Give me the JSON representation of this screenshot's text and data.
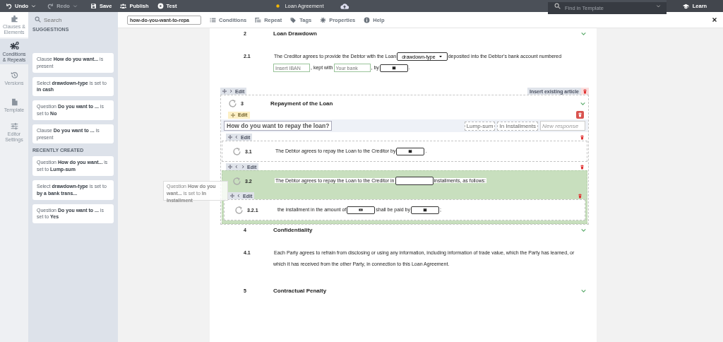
{
  "top_bar": {
    "actions": [
      {
        "kind": "undo",
        "label": "Undo",
        "disabled": false,
        "dropdown": true
      },
      {
        "kind": "redo",
        "label": "Redo",
        "disabled": true,
        "dropdown": true
      },
      {
        "kind": "save",
        "label": "Save",
        "disabled": false,
        "dropdown": false
      },
      {
        "kind": "publish",
        "label": "Publish",
        "disabled": false,
        "dropdown": false
      },
      {
        "kind": "test",
        "label": "Test",
        "disabled": false,
        "dropdown": false
      }
    ],
    "document_title": "Loan Agreement",
    "search": {
      "placeholder": "Find in Template"
    },
    "learn_button": "Learn"
  },
  "toolbar": {
    "name_field": {
      "value": "how-do-you-want-to-repa"
    },
    "tabs": [
      {
        "kind": "conditions",
        "label": "Conditions"
      },
      {
        "kind": "repeat",
        "label": "Repeat"
      },
      {
        "kind": "tags",
        "label": "Tags"
      },
      {
        "kind": "properties",
        "label": "Properties"
      },
      {
        "kind": "help",
        "label": "Help"
      }
    ]
  },
  "rail": {
    "items": [
      {
        "kind": "clauses",
        "label": "Clauses & Elements",
        "selected": false
      },
      {
        "kind": "conditions",
        "label": "Conditions & Repeats",
        "selected": true
      },
      {
        "kind": "versions",
        "label": "Versions",
        "selected": false
      },
      {
        "kind": "template",
        "label": "Template",
        "selected": false
      },
      {
        "kind": "settings",
        "label": "Editor Settings",
        "selected": false
      }
    ]
  },
  "sidebar": {
    "search": {
      "placeholder": "Search"
    },
    "sections": [
      {
        "title": "SUGGESTIONS",
        "items": [
          "Clause **How do you want...** is present",
          "Select **drawdown-type** is set to **in cash**",
          "Question **Do you want to ...** is set to **No**",
          "Clause **Do you want to ...** is present"
        ]
      },
      {
        "title": "RECENTLY CREATED",
        "items": [
          "Question **How do you want...** is set to **Lump-sum**",
          "Select **drawdown-type** is set to **by a bank trans...**",
          "Question **Do you want to ...** is set to **Yes**"
        ]
      }
    ]
  },
  "document": {
    "articles": [
      {
        "number": "2",
        "title": "Loan Drawdown",
        "clauses": [
          {
            "number": "2.1",
            "segments": [
              {
                "kind": "text",
                "text": "The Creditor agrees to provide the Debtor with the Loan"
              },
              {
                "kind": "select",
                "text": "drawdown-type"
              },
              {
                "kind": "text",
                "text": "deposited into the Debtor’s bank account"
              },
              {
                "kind": "text",
                "text": "numbered"
              },
              {
                "kind": "field",
                "placeholder": "Insert IBAN"
              },
              {
                "kind": "text",
                "text": ", kept with"
              },
              {
                "kind": "field",
                "placeholder": "Your bank"
              },
              {
                "kind": "text",
                "text": ", by"
              },
              {
                "kind": "date"
              },
              {
                "kind": "text",
                "text": "."
              }
            ]
          }
        ]
      },
      {
        "number": "3",
        "title": "Repayment of the Loan",
        "controls": {
          "nav": {
            "left": false,
            "right": true
          },
          "edit": "Edit",
          "insert": "Insert existing article"
        },
        "question": {
          "edit": "Edit",
          "text": "How do you want to repay the loan?",
          "responses": [
            "Lump-sum",
            "In Installments"
          ],
          "new_response": {
            "placeholder": "New response"
          }
        },
        "clauses": [
          {
            "number": "3.1",
            "nav": {
              "left": true,
              "right": false
            },
            "edit": "Edit",
            "selected": false,
            "segments": [
              {
                "kind": "text",
                "text": "The Debtor agrees to repay the Loan to the Creditor by"
              },
              {
                "kind": "date"
              },
              {
                "kind": "text",
                "text": "."
              }
            ]
          },
          {
            "number": "3.2",
            "nav": {
              "left": true,
              "right": true
            },
            "edit": "Edit",
            "selected": true,
            "segments": [
              {
                "kind": "text",
                "text": "The Debtor agrees to repay the Loan to the Creditor in"
              },
              {
                "kind": "field"
              },
              {
                "kind": "text",
                "text": "installments, as follows:"
              }
            ],
            "children": [
              {
                "number": "3.2.1",
                "nav": {
                  "left": true,
                  "right": false
                },
                "edit": "Edit",
                "selected": false,
                "segments": [
                  {
                    "kind": "text",
                    "text": "the installment in the amount of"
                  },
                  {
                    "kind": "money"
                  },
                  {
                    "kind": "text",
                    "text": "shall be paid by"
                  },
                  {
                    "kind": "date"
                  },
                  {
                    "kind": "text",
                    "text": ";"
                  }
                ]
              }
            ]
          }
        ]
      },
      {
        "number": "4",
        "title": "Confidentiality",
        "clauses": [
          {
            "number": "4.1",
            "segments": [
              {
                "kind": "text",
                "text": "Each Party agrees to refrain from disclosing or using any information, including information of trade value, which the Party has learned, or which it has received from the other Party, in connection to this Loan Agreement."
              }
            ]
          }
        ]
      },
      {
        "number": "5",
        "title": "Contractual Penalty"
      }
    ]
  },
  "drag_preview": {
    "text": "Question **How do you want...** is set to **In Installment**"
  }
}
